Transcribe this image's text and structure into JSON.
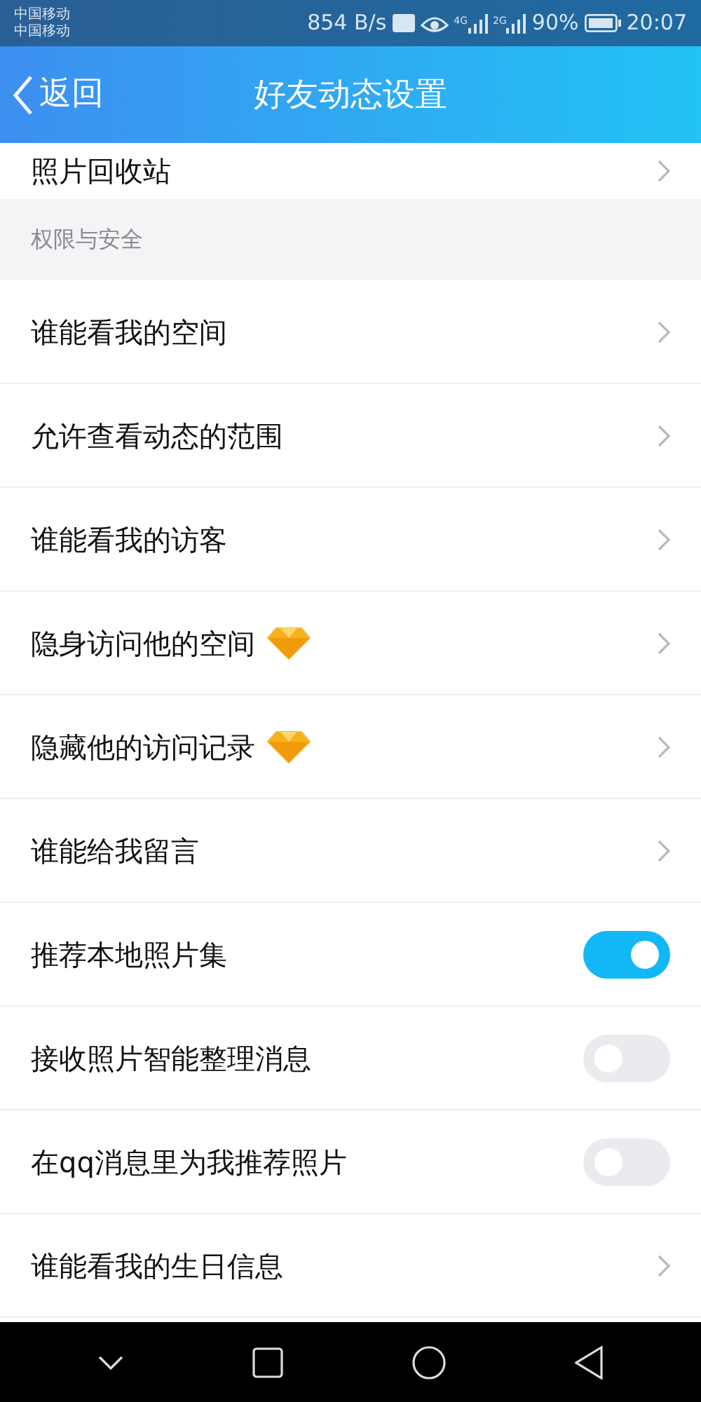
{
  "status_bar": {
    "carriers": [
      "中国移动",
      "中国移动"
    ],
    "speed": "854 B/s",
    "network_1": "4G",
    "network_2": "2G",
    "battery": "90%",
    "time": "20:07"
  },
  "header": {
    "back": "返回",
    "title": "好友动态设置"
  },
  "top_row": {
    "label": "照片回收站"
  },
  "section": {
    "title": "权限与安全"
  },
  "rows": [
    {
      "kind": "link",
      "label": "谁能看我的空间",
      "vip": false
    },
    {
      "kind": "link",
      "label": "允许查看动态的范围",
      "vip": false
    },
    {
      "kind": "link",
      "label": "谁能看我的访客",
      "vip": false
    },
    {
      "kind": "link",
      "label": "隐身访问他的空间",
      "vip": true
    },
    {
      "kind": "link",
      "label": "隐藏他的访问记录",
      "vip": true
    },
    {
      "kind": "link",
      "label": "谁能给我留言",
      "vip": false
    },
    {
      "kind": "toggle",
      "label": "推荐本地照片集",
      "on": true
    },
    {
      "kind": "toggle",
      "label": "接收照片智能整理消息",
      "on": false
    },
    {
      "kind": "toggle",
      "label": "在qq消息里为我推荐照片",
      "on": false
    },
    {
      "kind": "link",
      "label": "谁能看我的生日信息",
      "vip": false
    }
  ]
}
